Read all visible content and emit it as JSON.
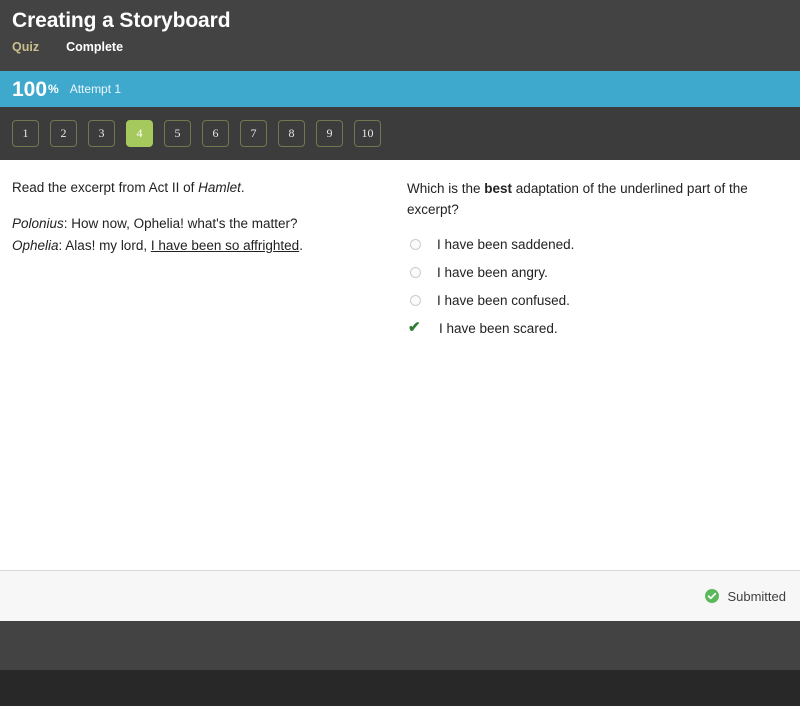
{
  "header": {
    "title": "Creating a Storyboard",
    "type_label": "Quiz",
    "status_label": "Complete",
    "type_color": "#c9c08c"
  },
  "score_bar": {
    "value": "100",
    "percent_symbol": "%",
    "attempt_label": "Attempt 1",
    "background_color": "#3fa9cd"
  },
  "question_nav": {
    "active_index": 4,
    "active_color": "#a5c95d",
    "buttons": [
      {
        "label": "1",
        "active": false
      },
      {
        "label": "2",
        "active": false
      },
      {
        "label": "3",
        "active": false
      },
      {
        "label": "4",
        "active": true
      },
      {
        "label": "5",
        "active": false
      },
      {
        "label": "6",
        "active": false
      },
      {
        "label": "7",
        "active": false
      },
      {
        "label": "8",
        "active": false
      },
      {
        "label": "9",
        "active": false
      },
      {
        "label": "10",
        "active": false
      }
    ]
  },
  "passage": {
    "intro_prefix": "Read the excerpt from Act II of ",
    "intro_work": "Hamlet",
    "intro_suffix": ".",
    "line1_speaker": "Polonius",
    "line1_text": ": How now, Ophelia! what's the matter?",
    "line2_speaker": "Ophelia",
    "line2_text_before": ": Alas! my lord, ",
    "line2_underlined": "I have been so affrighted",
    "line2_text_after": "."
  },
  "question": {
    "text_before": "Which is the ",
    "text_emphasis": "best",
    "text_after": " adaptation of the underlined part of the excerpt?",
    "options": [
      {
        "label": "I have been saddened.",
        "state": "unselected"
      },
      {
        "label": "I have been angry.",
        "state": "unselected"
      },
      {
        "label": "I have been confused.",
        "state": "unselected"
      },
      {
        "label": "I have been scared.",
        "state": "correct"
      }
    ],
    "correct_mark": "✔",
    "correct_color": "#2e7d32"
  },
  "footer": {
    "submitted_label": "Submitted",
    "submitted_color": "#5cb85c"
  }
}
